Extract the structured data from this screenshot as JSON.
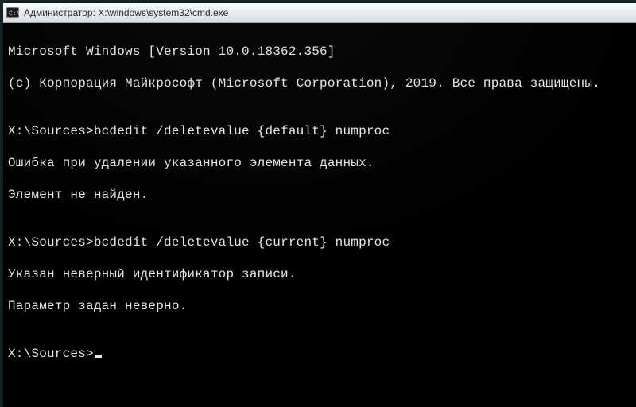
{
  "window": {
    "title": "Администратор: X:\\windows\\system32\\cmd.exe"
  },
  "terminal": {
    "banner_line1": "Microsoft Windows [Version 10.0.18362.356]",
    "banner_line2": "(c) Корпорация Майкрософт (Microsoft Corporation), 2019. Все права защищены.",
    "blank": "",
    "blocks": [
      {
        "prompt": "X:\\Sources>",
        "command": "bcdedit /deletevalue {default} numproc",
        "output": [
          "Ошибка при удалении указанного элемента данных.",
          "Элемент не найден."
        ]
      },
      {
        "prompt": "X:\\Sources>",
        "command": "bcdedit /deletevalue {current} numproc",
        "output": [
          "Указан неверный идентификатор записи.",
          "Параметр задан неверно."
        ]
      }
    ],
    "current_prompt": "X:\\Sources>"
  }
}
